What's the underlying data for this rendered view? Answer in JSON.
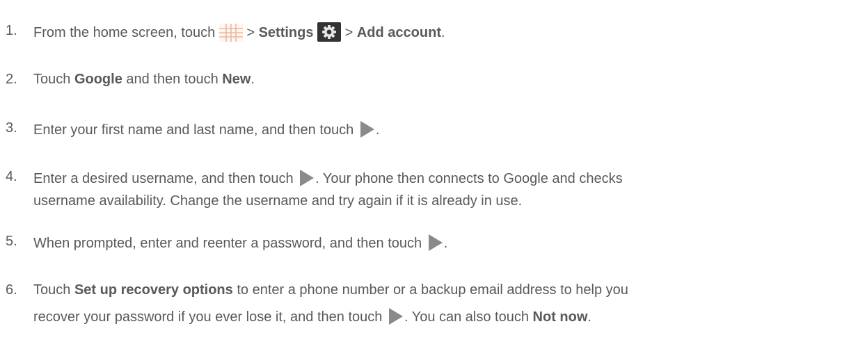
{
  "steps": [
    {
      "num": "1.",
      "t1": "From the home screen, touch ",
      "t2": " > ",
      "b1": "Settings",
      "t3": " > ",
      "b2": "Add account",
      "t4": "."
    },
    {
      "num": "2.",
      "t1": "Touch ",
      "b1": "Google",
      "t2": " and then touch ",
      "b2": "New",
      "t3": "."
    },
    {
      "num": "3.",
      "t1": "Enter your first name and last name, and then touch ",
      "t2": "."
    },
    {
      "num": "4.",
      "t1": "Enter a desired username, and then touch ",
      "t2": ". Your phone then connects to Google and checks",
      "t3": "username availability. Change the username and try again if it is already in use."
    },
    {
      "num": "5.",
      "t1": "When prompted, enter and reenter a password, and then touch ",
      "t2": "."
    },
    {
      "num": "6.",
      "t1": "Touch ",
      "b1": "Set up recovery options",
      "t2": " to enter a phone number or a backup email address to help you",
      "t3": "recover your password if you ever lose it, and then touch ",
      "t4": ". You can also touch ",
      "b2": "Not now",
      "t5": "."
    }
  ],
  "icons": {
    "apps": "apps-grid-icon",
    "settings": "settings-gear-icon",
    "next": "next-arrow-icon"
  }
}
